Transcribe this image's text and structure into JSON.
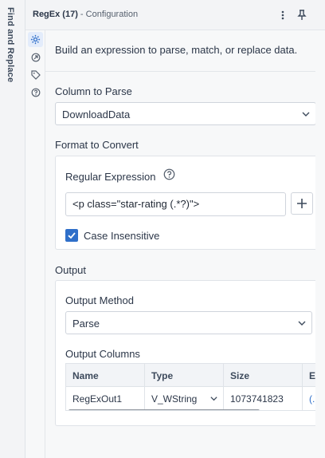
{
  "sidebar": {
    "label": "Find and Replace"
  },
  "header": {
    "tool_name": "RegEx (17)",
    "subtitle": "- Configuration",
    "more_icon": "more-vertical-icon",
    "pin_icon": "pin-icon"
  },
  "tabs": [
    {
      "icon": "gear-icon",
      "active": true
    },
    {
      "icon": "circle-arrow-icon",
      "active": false
    },
    {
      "icon": "tag-icon",
      "active": false
    },
    {
      "icon": "help-icon",
      "active": false
    }
  ],
  "description": "Build an expression to parse, match, or replace data.",
  "column_to_parse": {
    "label": "Column to Parse",
    "value": "DownloadData"
  },
  "format_to_convert": {
    "label": "Format to Convert",
    "regex_label": "Regular Expression",
    "regex_value": "<p class=\"star-rating (.*?)\">",
    "case_insensitive": {
      "label": "Case Insensitive",
      "checked": true
    }
  },
  "output": {
    "label": "Output",
    "method_label": "Output Method",
    "method_value": "Parse",
    "columns_label": "Output Columns",
    "table": {
      "headers": [
        "Name",
        "Type",
        "Size",
        "E"
      ],
      "rows": [
        {
          "name": "RegExOut1",
          "type": "V_WString",
          "size": "1073741823",
          "extra": "(."
        }
      ]
    }
  },
  "colors": {
    "accent": "#2f6fc9",
    "text": "#2b3648",
    "border": "#cfd4dc"
  }
}
